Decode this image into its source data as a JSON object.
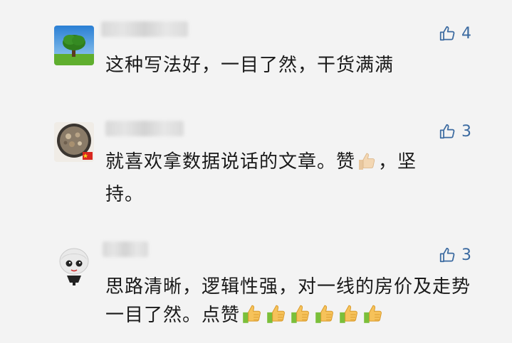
{
  "comments": [
    {
      "likes": "4",
      "text": "这种写法好，一目了然，干货满满"
    },
    {
      "likes": "3",
      "text_before": "就喜欢拿数据说话的文章。赞",
      "text_after": "，坚持。"
    },
    {
      "likes": "3",
      "text": "思路清晰，逻辑性强，对一线的房价及走势一目了然。点赞"
    }
  ],
  "icons": {
    "like": "thumbs-up-outline-icon",
    "emoji": "thumbs-up-emoji-icon"
  },
  "colors": {
    "background": "#f3f3f3",
    "like_accent": "#3b6aa0",
    "text": "#1a1a1a"
  }
}
